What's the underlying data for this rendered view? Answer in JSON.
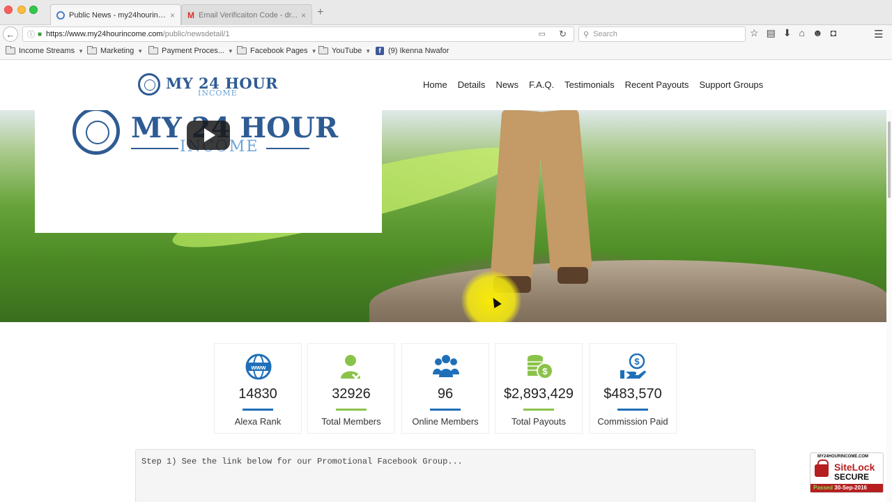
{
  "browser": {
    "tabs": [
      {
        "title": "Public News - my24hourinc...",
        "close": "×",
        "active": true
      },
      {
        "title": "Email Verificaiton Code - dr...",
        "close": "×",
        "active": false
      }
    ],
    "new_tab": "+",
    "url": {
      "host": "https://www.my24hourincome.com",
      "path": "/public/newsdetail/1"
    },
    "search_placeholder": "Search",
    "bookmarks": [
      {
        "label": "Income Streams",
        "type": "folder"
      },
      {
        "label": "Marketing",
        "type": "folder"
      },
      {
        "label": "Payment Proces...",
        "type": "folder"
      },
      {
        "label": "Facebook Pages",
        "type": "folder"
      },
      {
        "label": "YouTube",
        "type": "folder"
      },
      {
        "label": "(9) Ikenna Nwafor",
        "type": "facebook"
      }
    ]
  },
  "site": {
    "logo": {
      "title": "MY 24 HOUR",
      "subtitle": "INCOME"
    },
    "nav": [
      "Home",
      "Details",
      "News",
      "F.A.Q.",
      "Testimonials",
      "Recent Payouts",
      "Support Groups"
    ],
    "video": {
      "title": "MY 24 HOUR",
      "subtitle": "INCOME"
    },
    "stats": [
      {
        "value": "14830",
        "label": "Alexa Rank",
        "icon": "globe-www-icon",
        "bar_color": "#1f6fb8"
      },
      {
        "value": "32926",
        "label": "Total Members",
        "icon": "user-check-icon",
        "bar_color": "#8bc34a"
      },
      {
        "value": "96",
        "label": "Online Members",
        "icon": "users-group-icon",
        "bar_color": "#1f6fb8"
      },
      {
        "value": "$2,893,429",
        "label": "Total Payouts",
        "icon": "coins-dollar-icon",
        "bar_color": "#8bc34a"
      },
      {
        "value": "$483,570",
        "label": "Commission Paid",
        "icon": "hand-dollar-icon",
        "bar_color": "#1f6fb8"
      }
    ],
    "step_text": "Step 1) See the link below for our Promotional Facebook Group...",
    "sitelock": {
      "site": "MY24HOURINCOME.COM",
      "brand": "SiteLock",
      "status": "SECURE",
      "passed": "Passed",
      "date": "30-Sep-2016"
    }
  },
  "colors": {
    "brand_blue": "#2e5b93",
    "accent_green": "#8bc34a",
    "accent_blue": "#1f6fb8"
  }
}
